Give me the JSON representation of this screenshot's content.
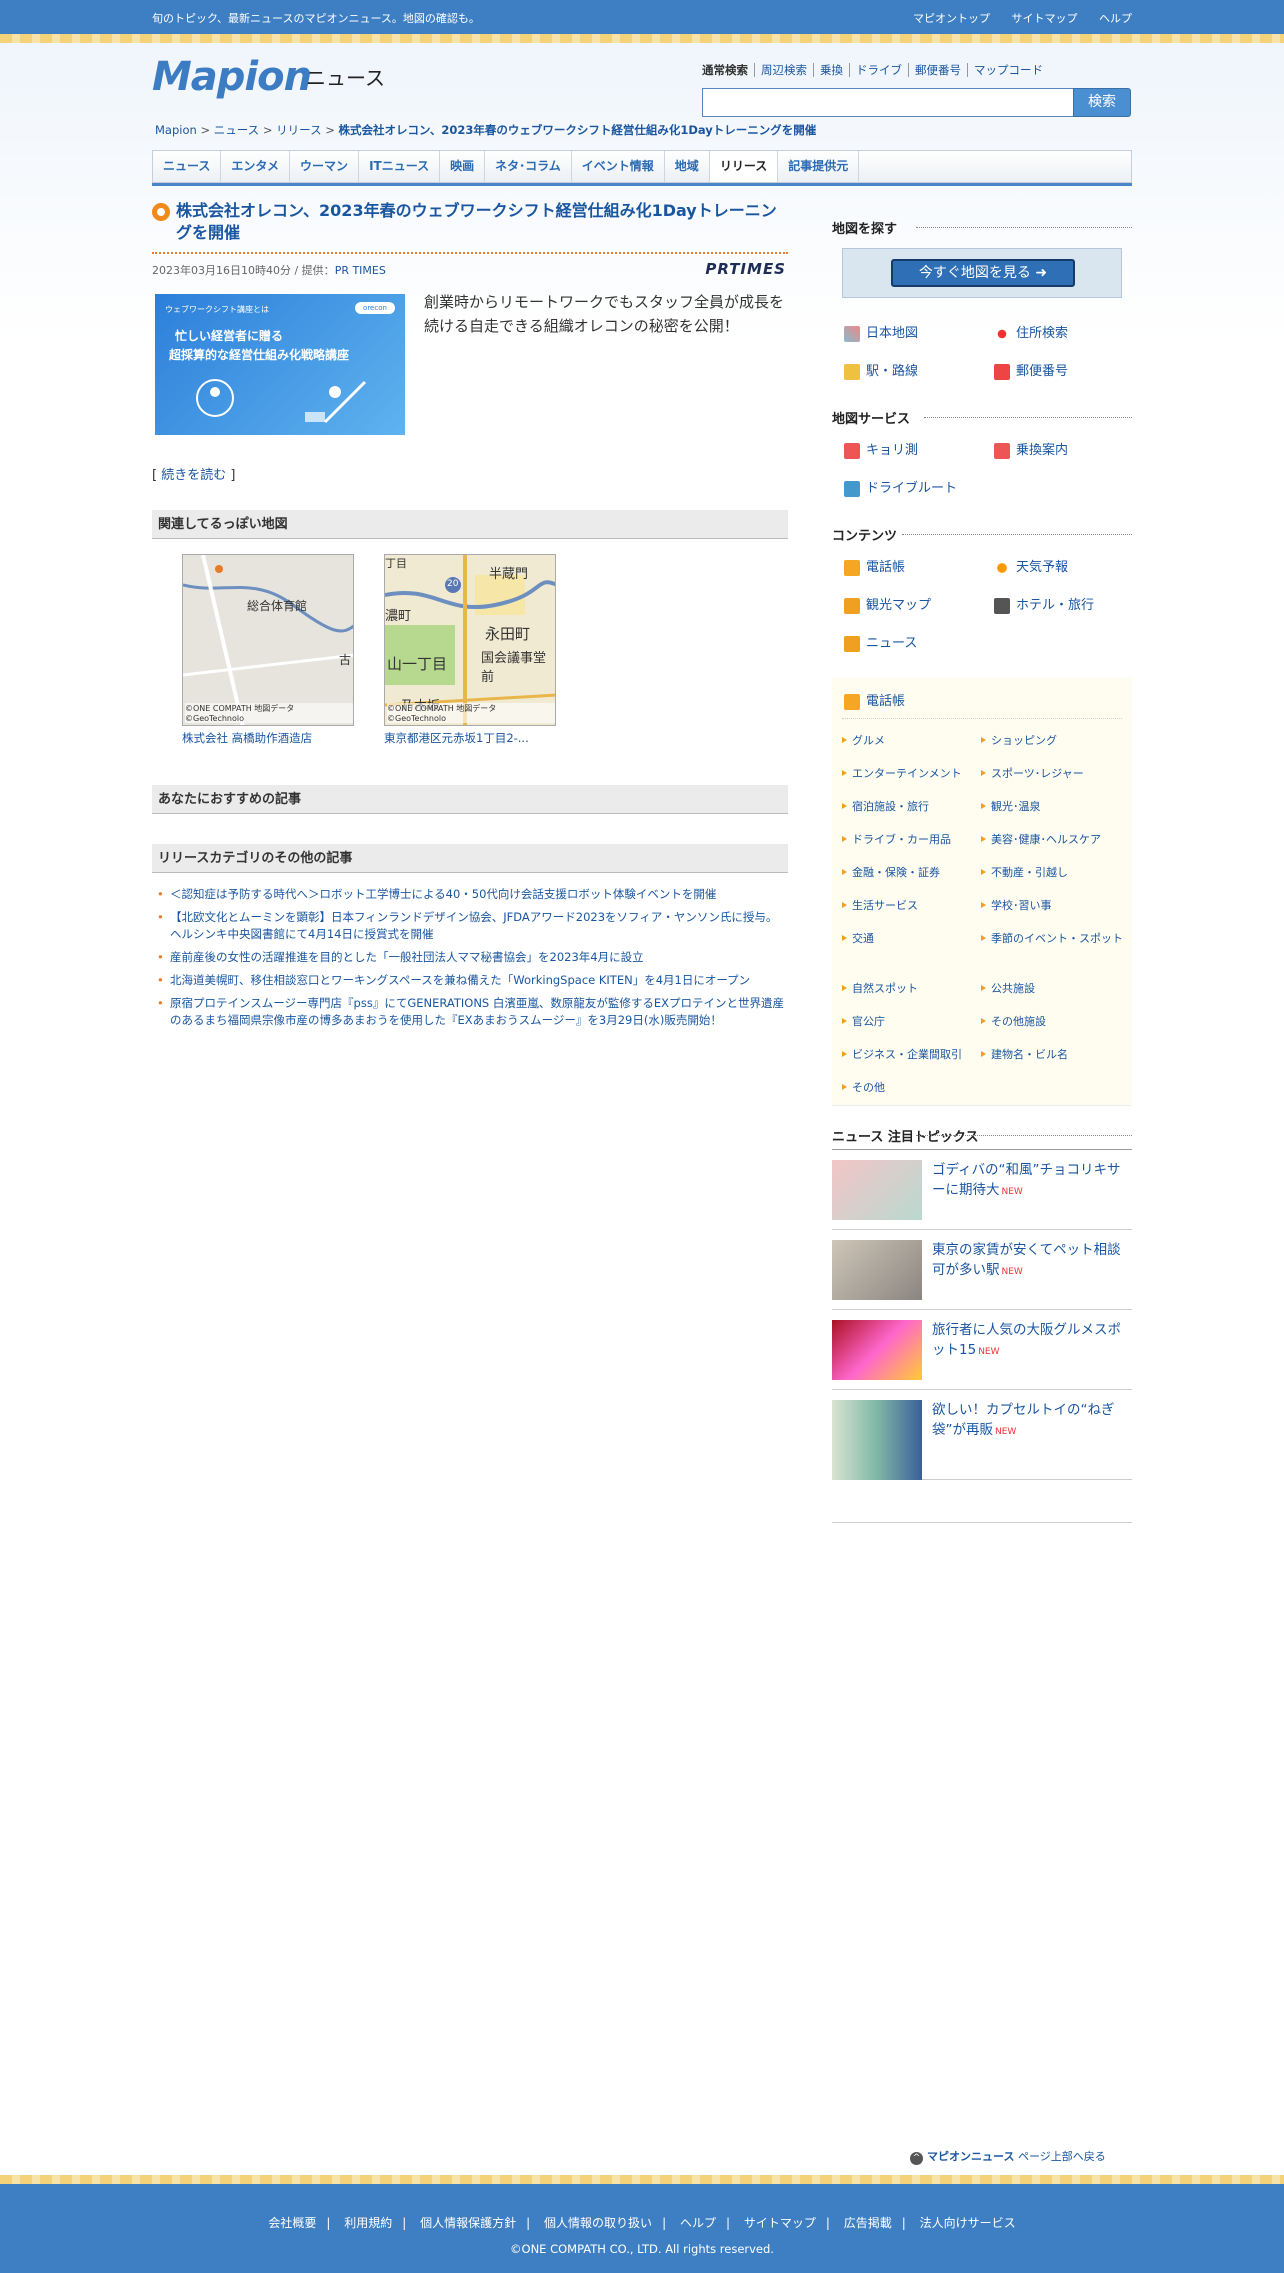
{
  "topbar": {
    "tagline": "旬のトピック、最新ニュースのマピオンニュース。地図の確認も。",
    "links": [
      "マピオントップ",
      "サイトマップ",
      "ヘルプ"
    ]
  },
  "header": {
    "logo": "Mapion",
    "section": "ニュース",
    "search_tabs": [
      "通常検索",
      "周辺検索",
      "乗換",
      "ドライブ",
      "郵便番号",
      "マップコード"
    ],
    "search_value": "",
    "search_button": "検索"
  },
  "breadcrumb": {
    "items": [
      "Mapion",
      "ニュース",
      "リリース"
    ],
    "current": "株式会社オレコン、2023年春のウェブワークシフト経営仕組み化1Dayトレーニングを開催"
  },
  "nav": {
    "tabs": [
      "ニュース",
      "エンタメ",
      "ウーマン",
      "ITニュース",
      "映画",
      "ネタ･コラム",
      "イベント情報",
      "地域",
      "リリース",
      "記事提供元"
    ],
    "active": "リリース"
  },
  "article": {
    "title": "株式会社オレコン、2023年春のウェブワークシフト経営仕組み化1Dayトレーニングを開催",
    "date": "2023年03月16日10時40分 / 提供：",
    "provider": "PR TIMES",
    "provider_logo": "PRTIMES",
    "image_texts": [
      "ウェブワークシフト講座とは",
      "orecon",
      "忙しい経営者に贈る",
      "超採算的な経営仕組み化戦略講座"
    ],
    "lead": "創業時からリモートワークでもスタッフ全員が成長を続ける自走できる組織オレコンの秘密を公開！",
    "read_more_open": "[ ",
    "read_more": "続きを読む",
    "read_more_close": " ]"
  },
  "maps": {
    "heading": "関連してるっぽい地図",
    "credit": "©ONE COMPATH 地図データ©GeoTechnolo",
    "items": [
      {
        "caption": "株式会社 高橋助作酒造店",
        "labels": [
          "総合体育館",
          "古"
        ]
      },
      {
        "caption": "東京都港区元赤坂1丁目2-...",
        "labels": [
          "半蔵門",
          "永田町",
          "山一丁目",
          "国会議事堂前",
          "乃木坂",
          "20",
          "濃町",
          "丁目"
        ]
      }
    ]
  },
  "recommend": {
    "heading": "あなたにおすすめの記事"
  },
  "related": {
    "heading": "リリースカテゴリのその他の記事",
    "items": [
      "＜認知症は予防する時代へ＞ロボット工学博士による40・50代向け会話支援ロボット体験イベントを開催",
      "【北欧文化とムーミンを顕彰】日本フィンランドデザイン協会、JFDAアワード2023をソフィア・ヤンソン氏に授与。ヘルシンキ中央図書館にて4月14日に授賞式を開催",
      "産前産後の女性の活躍推進を目的とした「一般社団法人ママ秘書協会」を2023年4月に設立",
      "北海道美幌町、移住相談窓口とワーキングスペースを兼ね備えた「WorkingSpace KITEN」を4月1日にオープン",
      "原宿プロテインスムージー専門店『pss』にてGENERATIONS 白濱亜嵐、数原龍友が監修するEXプロテインと世界遺産のあるまち福岡県宗像市産の博多あまおうを使用した『EXあまおうスムージー』を3月29日(水)販売開始！"
    ]
  },
  "sidebar": {
    "find_map": {
      "heading": "地図を探す",
      "button": "今すぐ地図を見る",
      "items": [
        "日本地図",
        "住所検索",
        "駅・路線",
        "郵便番号"
      ]
    },
    "map_service": {
      "heading": "地図サービス",
      "items": [
        "キョリ測",
        "乗換案内",
        "ドライブルート"
      ]
    },
    "contents": {
      "heading": "コンテンツ",
      "items": [
        "電話帳",
        "天気予報",
        "観光マップ",
        "ホテル・旅行",
        "ニュース"
      ]
    },
    "phonebook": {
      "heading": "電話帳",
      "categories": [
        "グルメ",
        "ショッピング",
        "エンターテインメント",
        "スポーツ･レジャー",
        "宿泊施設・旅行",
        "観光･温泉",
        "ドライブ・カー用品",
        "美容･健康･ヘルスケア",
        "金融・保険・証券",
        "不動産・引越し",
        "生活サービス",
        "学校･習い事",
        "交通",
        "季節のイベント・スポット",
        "自然スポット",
        "公共施設",
        "官公庁",
        "その他施設",
        "ビジネス・企業間取引",
        "建物名・ビル名",
        "その他"
      ]
    },
    "topics": {
      "heading": "ニュース 注目トピックス",
      "new_label": "NEW",
      "items": [
        "ゴディバの“和風”チョコリキサーに期待大",
        "東京の家賃が安くてペット相談可が多い駅",
        "旅行者に人気の大阪グルメスポット15",
        "欲しい！カプセルトイの“ねぎ袋”が再販"
      ]
    }
  },
  "pagetop": {
    "brand": "マピオンニュース",
    "label": "ページ上部へ戻る"
  },
  "footer": {
    "links": [
      "会社概要",
      "利用規約",
      "個人情報保護方針",
      "個人情報の取り扱い",
      "ヘルプ",
      "サイトマップ",
      "広告掲載",
      "法人向けサービス"
    ],
    "copyright": "©ONE COMPATH CO., LTD. All rights reserved."
  }
}
